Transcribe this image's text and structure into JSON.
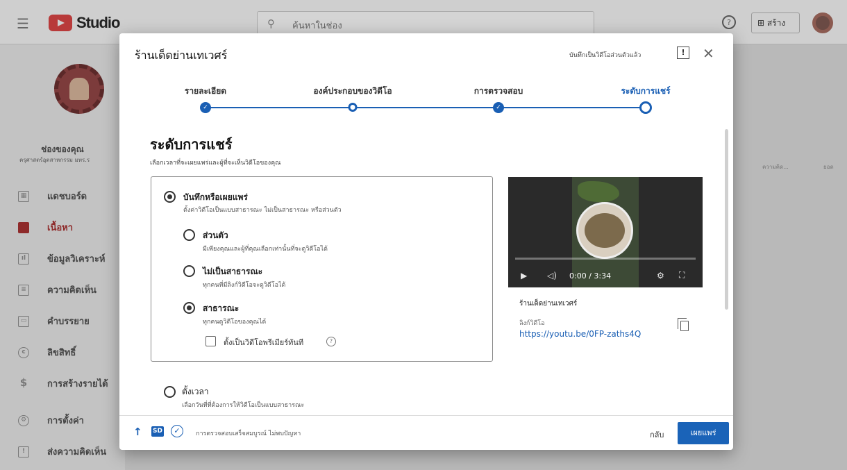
{
  "app": {
    "logo_text": "Studio"
  },
  "topbar": {
    "search_placeholder": "ค้นหาในช่อง",
    "create_label": "สร้าง"
  },
  "sidebar": {
    "channel_name": "ช่องของคุณ",
    "channel_sub": "ครุศาสตร์อุตสาหกรรม มทร.ร",
    "items": [
      {
        "label": "แดชบอร์ด",
        "icon": "dashboard-icon"
      },
      {
        "label": "เนื้อหา",
        "icon": "content-icon"
      },
      {
        "label": "ข้อมูลวิเคราะห์",
        "icon": "analytics-icon"
      },
      {
        "label": "ความคิดเห็น",
        "icon": "comments-icon"
      },
      {
        "label": "คำบรรยาย",
        "icon": "subtitles-icon"
      },
      {
        "label": "ลิขสิทธิ์",
        "icon": "copyright-icon"
      },
      {
        "label": "การสร้างรายได้",
        "icon": "monetization-icon"
      },
      {
        "label": "การตั้งค่า",
        "icon": "settings-icon"
      },
      {
        "label": "ส่งความคิดเห็น",
        "icon": "feedback-icon"
      }
    ],
    "bg_col1": "ความคิด...",
    "bg_col2": "ยอด"
  },
  "dialog": {
    "title": "ร้านเด็ดย่านเทเวศร์",
    "saved_status": "บันทึกเป็นวิดีโอส่วนตัวแล้ว",
    "steps": [
      {
        "label": "รายละเอียด",
        "state": "done"
      },
      {
        "label": "องค์ประกอบของวิดีโอ",
        "state": "open"
      },
      {
        "label": "การตรวจสอบ",
        "state": "done"
      },
      {
        "label": "ระดับการแชร์",
        "state": "current"
      }
    ],
    "heading": "ระดับการแชร์",
    "subheading": "เลือกเวลาที่จะเผยแพร่และผู้ที่จะเห็นวิดีโอของคุณ",
    "save_publish": {
      "label": "บันทึกหรือเผยแพร่",
      "desc": "ตั้งค่าวิดีโอเป็นแบบสาธารณะ ไม่เป็นสาธารณะ หรือส่วนตัว"
    },
    "options": [
      {
        "label": "ส่วนตัว",
        "desc": "มีเพียงคุณและผู้ที่คุณเลือกเท่านั้นที่จะดูวิดีโอได้",
        "selected": false
      },
      {
        "label": "ไม่เป็นสาธารณะ",
        "desc": "ทุกคนที่มีลิงก์วิดีโอจะดูวิดีโอได้",
        "selected": false
      },
      {
        "label": "สาธารณะ",
        "desc": "ทุกคนดูวิดีโอของคุณได้",
        "selected": true
      }
    ],
    "premiere_label": "ตั้งเป็นวิดีโอพรีเมียร์ทันที",
    "schedule": {
      "label": "ตั้งเวลา",
      "desc": "เลือกวันที่ที่ต้องการให้วิดีโอเป็นแบบสาธารณะ"
    },
    "video": {
      "time": "0:00 / 3:34",
      "title": "ร้านเด็ดย่านเทเวศร์",
      "link_label": "ลิงก์วิดีโอ",
      "link": "https://youtu.be/0FP-zaths4Q"
    },
    "footer": {
      "sd_badge": "SD",
      "status": "การตรวจสอบเสร็จสมบูรณ์ ไม่พบปัญหา",
      "back_label": "กลับ",
      "publish_label": "เผยแพร่"
    }
  }
}
